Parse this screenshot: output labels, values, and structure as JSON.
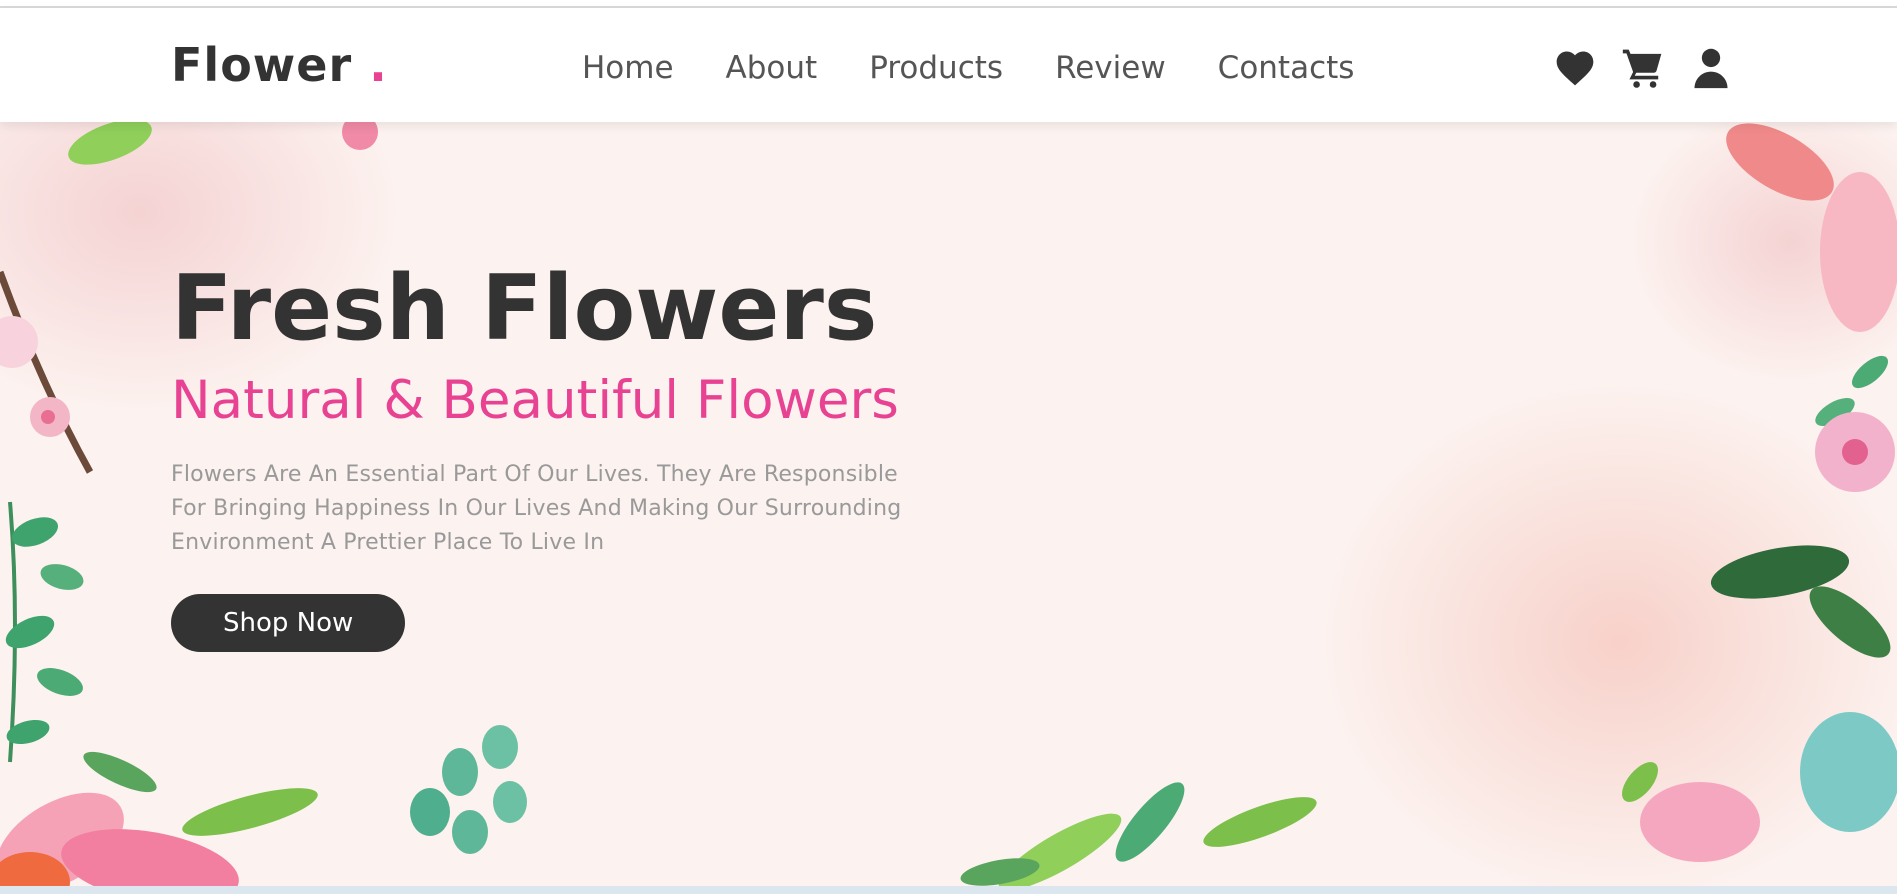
{
  "brand": {
    "name": "Flower",
    "dot": ".",
    "accent_color": "#e84393",
    "text_color": "#333333"
  },
  "nav": {
    "links": [
      {
        "label": "Home"
      },
      {
        "label": "About"
      },
      {
        "label": "Products"
      },
      {
        "label": "Review"
      },
      {
        "label": "Contacts"
      }
    ],
    "icons": [
      "heart-icon",
      "cart-icon",
      "user-icon"
    ]
  },
  "hero": {
    "title": "Fresh Flowers",
    "subtitle": "Natural & Beautiful Flowers",
    "description": "Flowers Are An Essential Part Of Our Lives. They Are Responsible For Bringing Happiness In Our Lives And Making Our Surrounding Environment A Prettier Place To Live In",
    "cta_label": "Shop Now",
    "background_color": "#fcf2ef"
  }
}
